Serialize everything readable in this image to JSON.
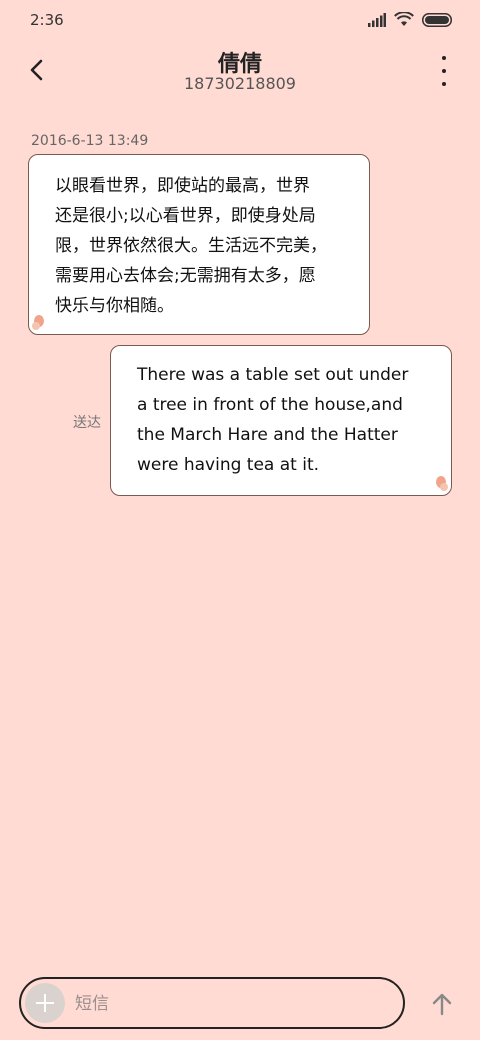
{
  "status_bar": {
    "time": "2:36"
  },
  "header": {
    "contact_name": "倩倩",
    "contact_phone": "18730218809"
  },
  "conversation": {
    "timestamp": "2016-6-13 13:49",
    "messages": [
      {
        "direction": "incoming",
        "text": "以眼看世界，即使站的最高，世界\n还是很小;以心看世界，即使身处局\n限，世界依然很大。生活远不完美，\n需要用心去体会;无需拥有太多，愿\n快乐与你相随。"
      },
      {
        "direction": "outgoing",
        "text": "There was a table set out under\na tree in front of the house,and\nthe March Hare and the Hatter\nwere having tea at it.",
        "status": "送达"
      }
    ]
  },
  "composer": {
    "placeholder": "短信",
    "add_icon": "plus-icon",
    "send_icon": "arrow-up-icon"
  },
  "colors": {
    "background": "#ffdbd3",
    "bubble": "#ffffff",
    "bubble_border": "#7a5a50"
  }
}
